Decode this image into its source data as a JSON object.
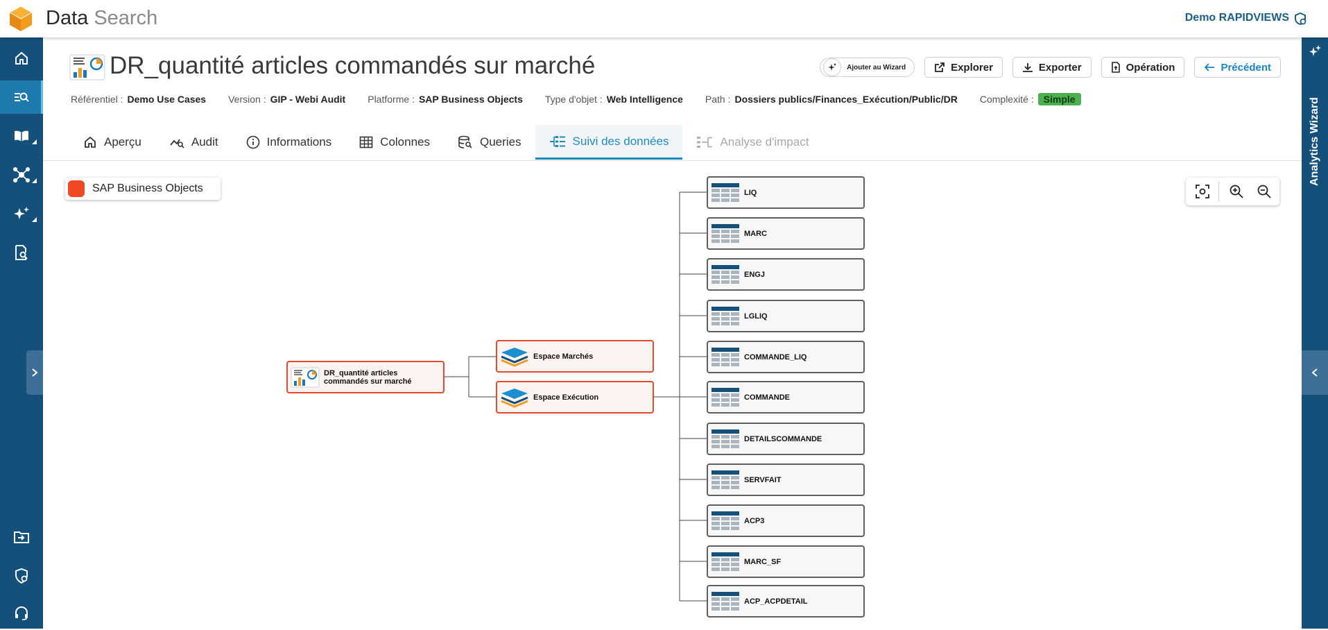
{
  "app": {
    "title_main": "Data",
    "title_sub": "Search",
    "user": "Demo RAPIDVIEWS"
  },
  "sidebar": {
    "items": [
      {
        "name": "home",
        "icon": "home-icon"
      },
      {
        "name": "data-search",
        "icon": "search-list-icon",
        "active": true
      },
      {
        "name": "glossary",
        "icon": "book-icon"
      },
      {
        "name": "lineage",
        "icon": "network-icon"
      },
      {
        "name": "ai",
        "icon": "sparkle-icon"
      },
      {
        "name": "reports",
        "icon": "report-search-icon"
      },
      {
        "name": "import",
        "icon": "folder-in-icon"
      },
      {
        "name": "admin",
        "icon": "shield-settings-icon"
      },
      {
        "name": "support",
        "icon": "headset-icon"
      }
    ]
  },
  "right_panel": {
    "label": "Analytics Wizard"
  },
  "header": {
    "title": "DR_quantité articles commandés sur marché",
    "actions": {
      "wizard": "Ajouter au Wizard",
      "explore": "Explorer",
      "export": "Exporter",
      "operation": "Opération",
      "back": "Précédent"
    },
    "meta": [
      {
        "key": "Référentiel :",
        "value": "Demo Use Cases"
      },
      {
        "key": "Version :",
        "value": "GIP - Webi Audit"
      },
      {
        "key": "Platforme :",
        "value": "SAP Business Objects"
      },
      {
        "key": "Type d'objet :",
        "value": "Web Intelligence"
      },
      {
        "key": "Path :",
        "value": "Dossiers publics/Finances_Exécution/Public/DR"
      }
    ],
    "complexity_label": "Complexité :",
    "complexity_value": "Simple"
  },
  "tabs": [
    {
      "label": "Aperçu",
      "icon": "home-icon"
    },
    {
      "label": "Audit",
      "icon": "trend-search-icon"
    },
    {
      "label": "Informations",
      "icon": "info-icon"
    },
    {
      "label": "Colonnes",
      "icon": "table-icon"
    },
    {
      "label": "Queries",
      "icon": "database-search-icon"
    },
    {
      "label": "Suivi des données",
      "icon": "lineage-icon",
      "active": true
    },
    {
      "label": "Analyse d'impact",
      "icon": "impact-icon",
      "disabled": true
    }
  ],
  "legend": {
    "label": "SAP Business Objects",
    "color": "#f04823"
  },
  "graph": {
    "report": {
      "line1": "DR_quantité articles",
      "line2": "commandés sur marché"
    },
    "universes": [
      "Espace Marchés",
      "Espace Exécution"
    ],
    "tables": [
      "LIQ",
      "MARC",
      "ENGJ",
      "LGLIQ",
      "COMMANDE_LIQ",
      "COMMANDE",
      "DETAILSCOMMANDE",
      "SERVFAIT",
      "ACP3",
      "MARC_SF",
      "ACP_ACPDETAIL"
    ]
  },
  "colors": {
    "brand": "#14507a",
    "accent": "#1e8ac4",
    "node_red": "#e24b2b",
    "complexity": "#4caf50"
  }
}
